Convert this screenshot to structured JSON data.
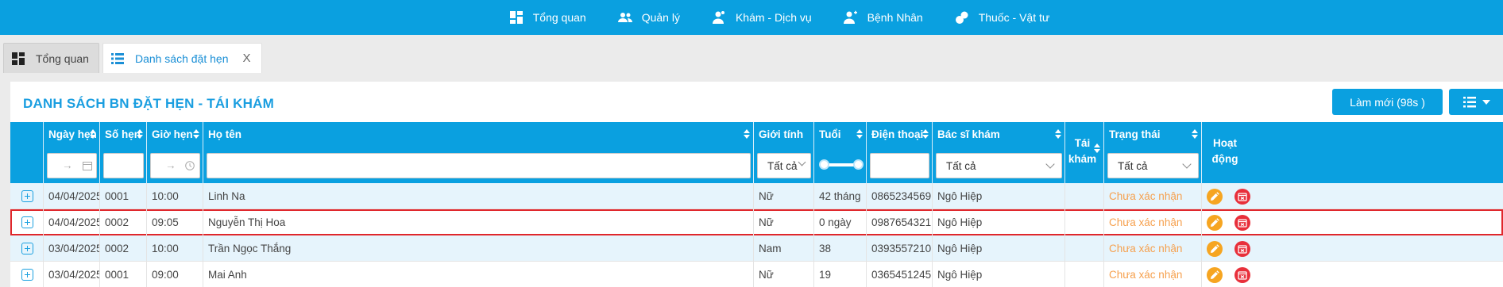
{
  "nav": [
    {
      "label": "Tổng quan",
      "icon": "dashboard-icon"
    },
    {
      "label": "Quản lý",
      "icon": "users-icon"
    },
    {
      "label": "Khám - Dịch vụ",
      "icon": "doctor-icon"
    },
    {
      "label": "Bệnh Nhân",
      "icon": "patient-icon"
    },
    {
      "label": "Thuốc - Vật tư",
      "icon": "medicine-icon"
    }
  ],
  "tabs": [
    {
      "label": "Tổng quan",
      "icon": "dashboard-icon",
      "active": false
    },
    {
      "label": "Danh sách đặt hẹn",
      "icon": "list-icon",
      "active": true,
      "close": "X"
    }
  ],
  "panel": {
    "title": "DANH SÁCH BN ĐẶT HẸN - TÁI KHÁM",
    "refresh_label": "Làm mới (98s )"
  },
  "columns": {
    "ngay_hen": "Ngày hẹn",
    "so_hen": "Số hẹn",
    "gio_hen": "Giờ hẹn",
    "ho_ten": "Họ tên",
    "gioi_tinh": "Giới tính",
    "tuoi": "Tuổi",
    "dien_thoai": "Điện thoại",
    "bac_si": "Bác sĩ khám",
    "tai_kham_1": "Tái",
    "tai_kham_2": "khám",
    "trang_thai": "Trạng thái",
    "hoat_dong_1": "Hoạt",
    "hoat_dong_2": "động"
  },
  "filters": {
    "date_arrow": "→",
    "time_arrow": "→",
    "gioi_tinh": "Tất cả",
    "bac_si": "Tất cả",
    "trang_thai": "Tất cả"
  },
  "rows": [
    {
      "ngay_hen": "04/04/2025",
      "so_hen": "0001",
      "gio_hen": "10:00",
      "ho_ten": "Linh Na",
      "gioi_tinh": "Nữ",
      "tuoi": "42 tháng",
      "dien_thoai": "0865234569",
      "bac_si": "Ngô Hiệp",
      "trang_thai": "Chưa xác nhận"
    },
    {
      "ngay_hen": "04/04/2025",
      "so_hen": "0002",
      "gio_hen": "09:05",
      "ho_ten": "Nguyễn Thị Hoa",
      "gioi_tinh": "Nữ",
      "tuoi": "0 ngày",
      "dien_thoai": "0987654321",
      "bac_si": "Ngô Hiệp",
      "trang_thai": "Chưa xác nhận"
    },
    {
      "ngay_hen": "03/04/2025",
      "so_hen": "0002",
      "gio_hen": "10:00",
      "ho_ten": "Trần Ngọc Thắng",
      "gioi_tinh": "Nam",
      "tuoi": "38",
      "dien_thoai": "0393557210",
      "bac_si": "Ngô Hiệp",
      "trang_thai": "Chưa xác nhận"
    },
    {
      "ngay_hen": "03/04/2025",
      "so_hen": "0001",
      "gio_hen": "09:00",
      "ho_ten": "Mai Anh",
      "gioi_tinh": "Nữ",
      "tuoi": "19",
      "dien_thoai": "0365451245",
      "bac_si": "Ngô Hiệp",
      "trang_thai": "Chưa xác nhận"
    }
  ],
  "colors": {
    "primary": "#0aa0e0",
    "status_pending": "#f6a04d",
    "edit": "#f6a521",
    "cancel": "#e8303b",
    "highlight_border": "#e0262b"
  }
}
